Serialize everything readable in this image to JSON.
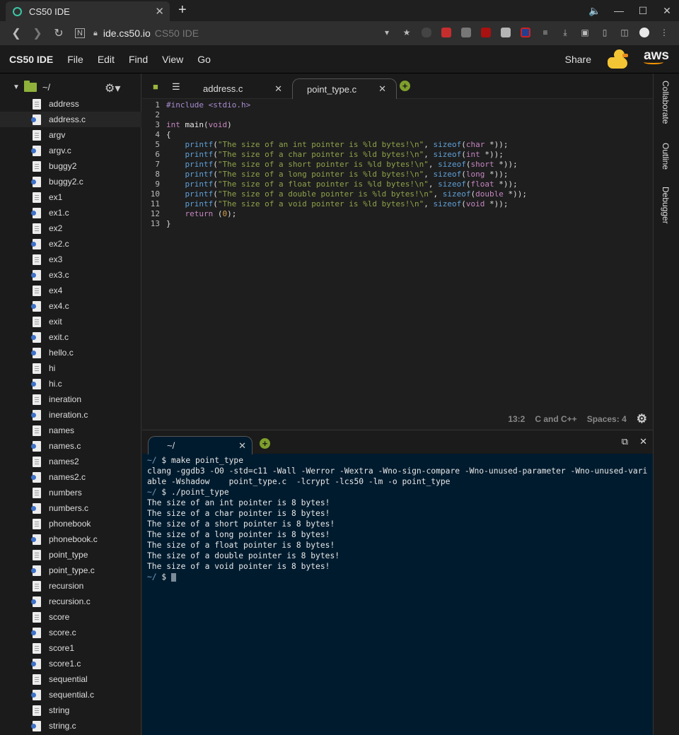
{
  "browser": {
    "tab_title": "CS50 IDE",
    "tab_close": "✕",
    "new_tab": "+",
    "url": "ide.cs50.io",
    "url_title": "CS50 IDE",
    "window_controls": [
      "🔈",
      "—",
      "☐",
      "✕"
    ]
  },
  "menubar": {
    "brand": "CS50 IDE",
    "items": [
      "File",
      "Edit",
      "Find",
      "View",
      "Go"
    ],
    "share": "Share",
    "aws": "aws"
  },
  "sidebar": {
    "root": "~/",
    "files": [
      {
        "name": "address",
        "type": "file"
      },
      {
        "name": "address.c",
        "type": "c",
        "selected": true
      },
      {
        "name": "argv",
        "type": "file"
      },
      {
        "name": "argv.c",
        "type": "c"
      },
      {
        "name": "buggy2",
        "type": "file"
      },
      {
        "name": "buggy2.c",
        "type": "c"
      },
      {
        "name": "ex1",
        "type": "file"
      },
      {
        "name": "ex1.c",
        "type": "c"
      },
      {
        "name": "ex2",
        "type": "file"
      },
      {
        "name": "ex2.c",
        "type": "c"
      },
      {
        "name": "ex3",
        "type": "file"
      },
      {
        "name": "ex3.c",
        "type": "c"
      },
      {
        "name": "ex4",
        "type": "file"
      },
      {
        "name": "ex4.c",
        "type": "c"
      },
      {
        "name": "exit",
        "type": "file"
      },
      {
        "name": "exit.c",
        "type": "c"
      },
      {
        "name": "hello.c",
        "type": "c"
      },
      {
        "name": "hi",
        "type": "file"
      },
      {
        "name": "hi.c",
        "type": "c"
      },
      {
        "name": "ineration",
        "type": "file"
      },
      {
        "name": "ineration.c",
        "type": "c"
      },
      {
        "name": "names",
        "type": "file"
      },
      {
        "name": "names.c",
        "type": "c"
      },
      {
        "name": "names2",
        "type": "file"
      },
      {
        "name": "names2.c",
        "type": "c"
      },
      {
        "name": "numbers",
        "type": "file"
      },
      {
        "name": "numbers.c",
        "type": "c"
      },
      {
        "name": "phonebook",
        "type": "file"
      },
      {
        "name": "phonebook.c",
        "type": "c"
      },
      {
        "name": "point_type",
        "type": "file"
      },
      {
        "name": "point_type.c",
        "type": "c"
      },
      {
        "name": "recursion",
        "type": "file"
      },
      {
        "name": "recursion.c",
        "type": "c"
      },
      {
        "name": "score",
        "type": "file"
      },
      {
        "name": "score.c",
        "type": "c"
      },
      {
        "name": "score1",
        "type": "file"
      },
      {
        "name": "score1.c",
        "type": "c"
      },
      {
        "name": "sequential",
        "type": "file"
      },
      {
        "name": "sequential.c",
        "type": "c"
      },
      {
        "name": "string",
        "type": "file"
      },
      {
        "name": "string.c",
        "type": "c"
      }
    ]
  },
  "editor": {
    "tabs": [
      {
        "name": "address.c",
        "active": false
      },
      {
        "name": "point_type.c",
        "active": true
      }
    ],
    "close": "✕",
    "code": [
      [
        {
          "t": "#include <stdio.h>",
          "c": "#a78ccf"
        }
      ],
      [],
      [
        {
          "t": "int ",
          "c": "#c586c0"
        },
        {
          "t": "main",
          "c": "#e6e6e6"
        },
        {
          "t": "(",
          "c": "#ddd"
        },
        {
          "t": "void",
          "c": "#c586c0"
        },
        {
          "t": ")",
          "c": "#ddd"
        }
      ],
      [
        {
          "t": "{",
          "c": "#ddd"
        }
      ],
      [
        {
          "t": "    printf",
          "c": "#5fa0d8"
        },
        {
          "t": "(",
          "c": "#ddd"
        },
        {
          "t": "\"The size of an int pointer is %ld bytes!\\n\"",
          "c": "#8fa24a"
        },
        {
          "t": ", ",
          "c": "#ddd"
        },
        {
          "t": "sizeof",
          "c": "#5fa0d8"
        },
        {
          "t": "(",
          "c": "#ddd"
        },
        {
          "t": "char",
          "c": "#c586c0"
        },
        {
          "t": " *));",
          "c": "#ddd"
        }
      ],
      [
        {
          "t": "    printf",
          "c": "#5fa0d8"
        },
        {
          "t": "(",
          "c": "#ddd"
        },
        {
          "t": "\"The size of a char pointer is %ld bytes!\\n\"",
          "c": "#8fa24a"
        },
        {
          "t": ", ",
          "c": "#ddd"
        },
        {
          "t": "sizeof",
          "c": "#5fa0d8"
        },
        {
          "t": "(",
          "c": "#ddd"
        },
        {
          "t": "int",
          "c": "#c586c0"
        },
        {
          "t": " *));",
          "c": "#ddd"
        }
      ],
      [
        {
          "t": "    printf",
          "c": "#5fa0d8"
        },
        {
          "t": "(",
          "c": "#ddd"
        },
        {
          "t": "\"The size of a short pointer is %ld bytes!\\n\"",
          "c": "#8fa24a"
        },
        {
          "t": ", ",
          "c": "#ddd"
        },
        {
          "t": "sizeof",
          "c": "#5fa0d8"
        },
        {
          "t": "(",
          "c": "#ddd"
        },
        {
          "t": "short",
          "c": "#c586c0"
        },
        {
          "t": " *));",
          "c": "#ddd"
        }
      ],
      [
        {
          "t": "    printf",
          "c": "#5fa0d8"
        },
        {
          "t": "(",
          "c": "#ddd"
        },
        {
          "t": "\"The size of a long pointer is %ld bytes!\\n\"",
          "c": "#8fa24a"
        },
        {
          "t": ", ",
          "c": "#ddd"
        },
        {
          "t": "sizeof",
          "c": "#5fa0d8"
        },
        {
          "t": "(",
          "c": "#ddd"
        },
        {
          "t": "long",
          "c": "#c586c0"
        },
        {
          "t": " *));",
          "c": "#ddd"
        }
      ],
      [
        {
          "t": "    printf",
          "c": "#5fa0d8"
        },
        {
          "t": "(",
          "c": "#ddd"
        },
        {
          "t": "\"The size of a float pointer is %ld bytes!\\n\"",
          "c": "#8fa24a"
        },
        {
          "t": ", ",
          "c": "#ddd"
        },
        {
          "t": "sizeof",
          "c": "#5fa0d8"
        },
        {
          "t": "(",
          "c": "#ddd"
        },
        {
          "t": "float",
          "c": "#c586c0"
        },
        {
          "t": " *));",
          "c": "#ddd"
        }
      ],
      [
        {
          "t": "    printf",
          "c": "#5fa0d8"
        },
        {
          "t": "(",
          "c": "#ddd"
        },
        {
          "t": "\"The size of a double pointer is %ld bytes!\\n\"",
          "c": "#8fa24a"
        },
        {
          "t": ", ",
          "c": "#ddd"
        },
        {
          "t": "sizeof",
          "c": "#5fa0d8"
        },
        {
          "t": "(",
          "c": "#ddd"
        },
        {
          "t": "double",
          "c": "#c586c0"
        },
        {
          "t": " *));",
          "c": "#ddd"
        }
      ],
      [
        {
          "t": "    printf",
          "c": "#5fa0d8"
        },
        {
          "t": "(",
          "c": "#ddd"
        },
        {
          "t": "\"The size of a void pointer is %ld bytes!\\n\"",
          "c": "#8fa24a"
        },
        {
          "t": ", ",
          "c": "#ddd"
        },
        {
          "t": "sizeof",
          "c": "#5fa0d8"
        },
        {
          "t": "(",
          "c": "#ddd"
        },
        {
          "t": "void",
          "c": "#c586c0"
        },
        {
          "t": " *));",
          "c": "#ddd"
        }
      ],
      [
        {
          "t": "    return ",
          "c": "#c586c0"
        },
        {
          "t": "(",
          "c": "#ddd"
        },
        {
          "t": "0",
          "c": "#d7a04a"
        },
        {
          "t": ");",
          "c": "#ddd"
        }
      ],
      [
        {
          "t": "}",
          "c": "#ddd"
        }
      ]
    ],
    "status": {
      "position": "13:2",
      "language": "C and C++",
      "indent": "Spaces: 4"
    }
  },
  "rightpanel": [
    "Collaborate",
    "Outline",
    "Debugger"
  ],
  "terminal": {
    "tab": "~/",
    "close": "✕",
    "lines": [
      {
        "prompt": "~/",
        "text": " $ make point_type"
      },
      {
        "text": "clang -ggdb3 -O0 -std=c11 -Wall -Werror -Wextra -Wno-sign-compare -Wno-unused-parameter -Wno-unused-vari"
      },
      {
        "text": "able -Wshadow    point_type.c  -lcrypt -lcs50 -lm -o point_type"
      },
      {
        "prompt": "~/",
        "text": " $ ./point_type"
      },
      {
        "text": "The size of an int pointer is 8 bytes!"
      },
      {
        "text": "The size of a char pointer is 8 bytes!"
      },
      {
        "text": "The size of a short pointer is 8 bytes!"
      },
      {
        "text": "The size of a long pointer is 8 bytes!"
      },
      {
        "text": "The size of a float pointer is 8 bytes!"
      },
      {
        "text": "The size of a double pointer is 8 bytes!"
      },
      {
        "text": "The size of a void pointer is 8 bytes!"
      },
      {
        "prompt": "~/",
        "text": " $ ",
        "cursor": true
      }
    ]
  }
}
